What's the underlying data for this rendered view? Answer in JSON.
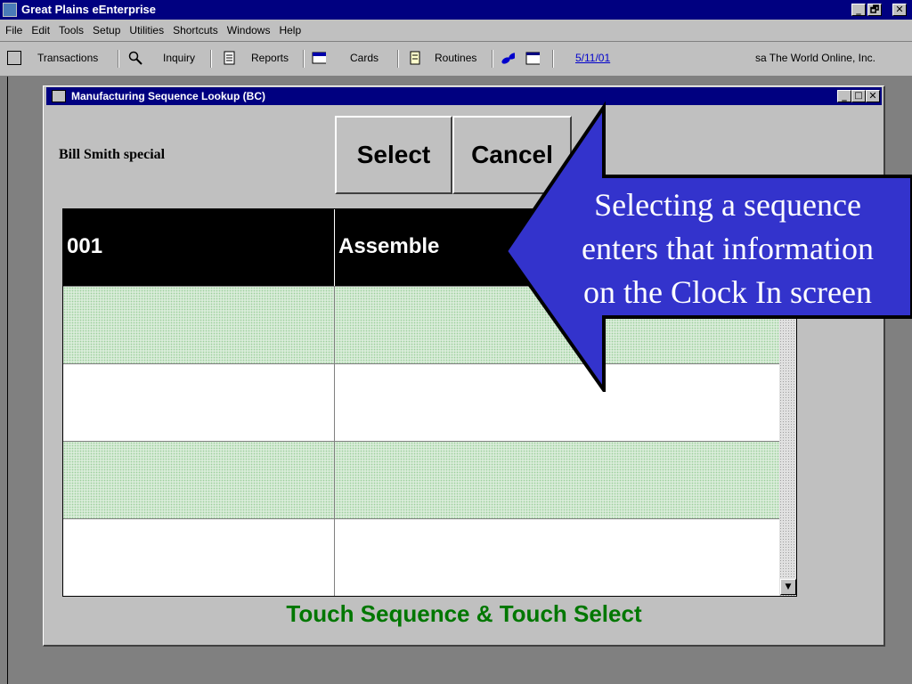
{
  "app": {
    "title": "Great Plains eEnterprise",
    "window_controls": {
      "minimize": "_",
      "maximize": "🗗",
      "close": "✕"
    }
  },
  "menu": {
    "items": [
      "File",
      "Edit",
      "Tools",
      "Setup",
      "Utilities",
      "Shortcuts",
      "Windows",
      "Help"
    ]
  },
  "toolbar": {
    "transactions": "Transactions",
    "inquiry": "Inquiry",
    "reports": "Reports",
    "cards": "Cards",
    "routines": "Routines",
    "date": "5/11/01",
    "user_company": "sa  The World Online, Inc."
  },
  "lookup_window": {
    "title": "Manufacturing Sequence Lookup (BC)",
    "batch_name": "Bill Smith special",
    "select_label": "Select",
    "cancel_label": "Cancel",
    "rows": [
      {
        "sequence": "001",
        "description": "Assemble",
        "selected": true
      },
      {
        "sequence": "",
        "description": "",
        "selected": false
      },
      {
        "sequence": "",
        "description": "",
        "selected": false
      },
      {
        "sequence": "",
        "description": "",
        "selected": false
      },
      {
        "sequence": "",
        "description": "",
        "selected": false
      }
    ],
    "instruction": "Touch Sequence & Touch Select",
    "scroll_down_glyph": "▼"
  },
  "callout": {
    "line1": "Selecting a sequence",
    "line2": "enters that information",
    "line3": "on the Clock In screen",
    "fill_color": "#3333cc"
  },
  "colors": {
    "titlebar": "#000080",
    "instruction_green": "#007700",
    "row_selected": "#000000"
  }
}
